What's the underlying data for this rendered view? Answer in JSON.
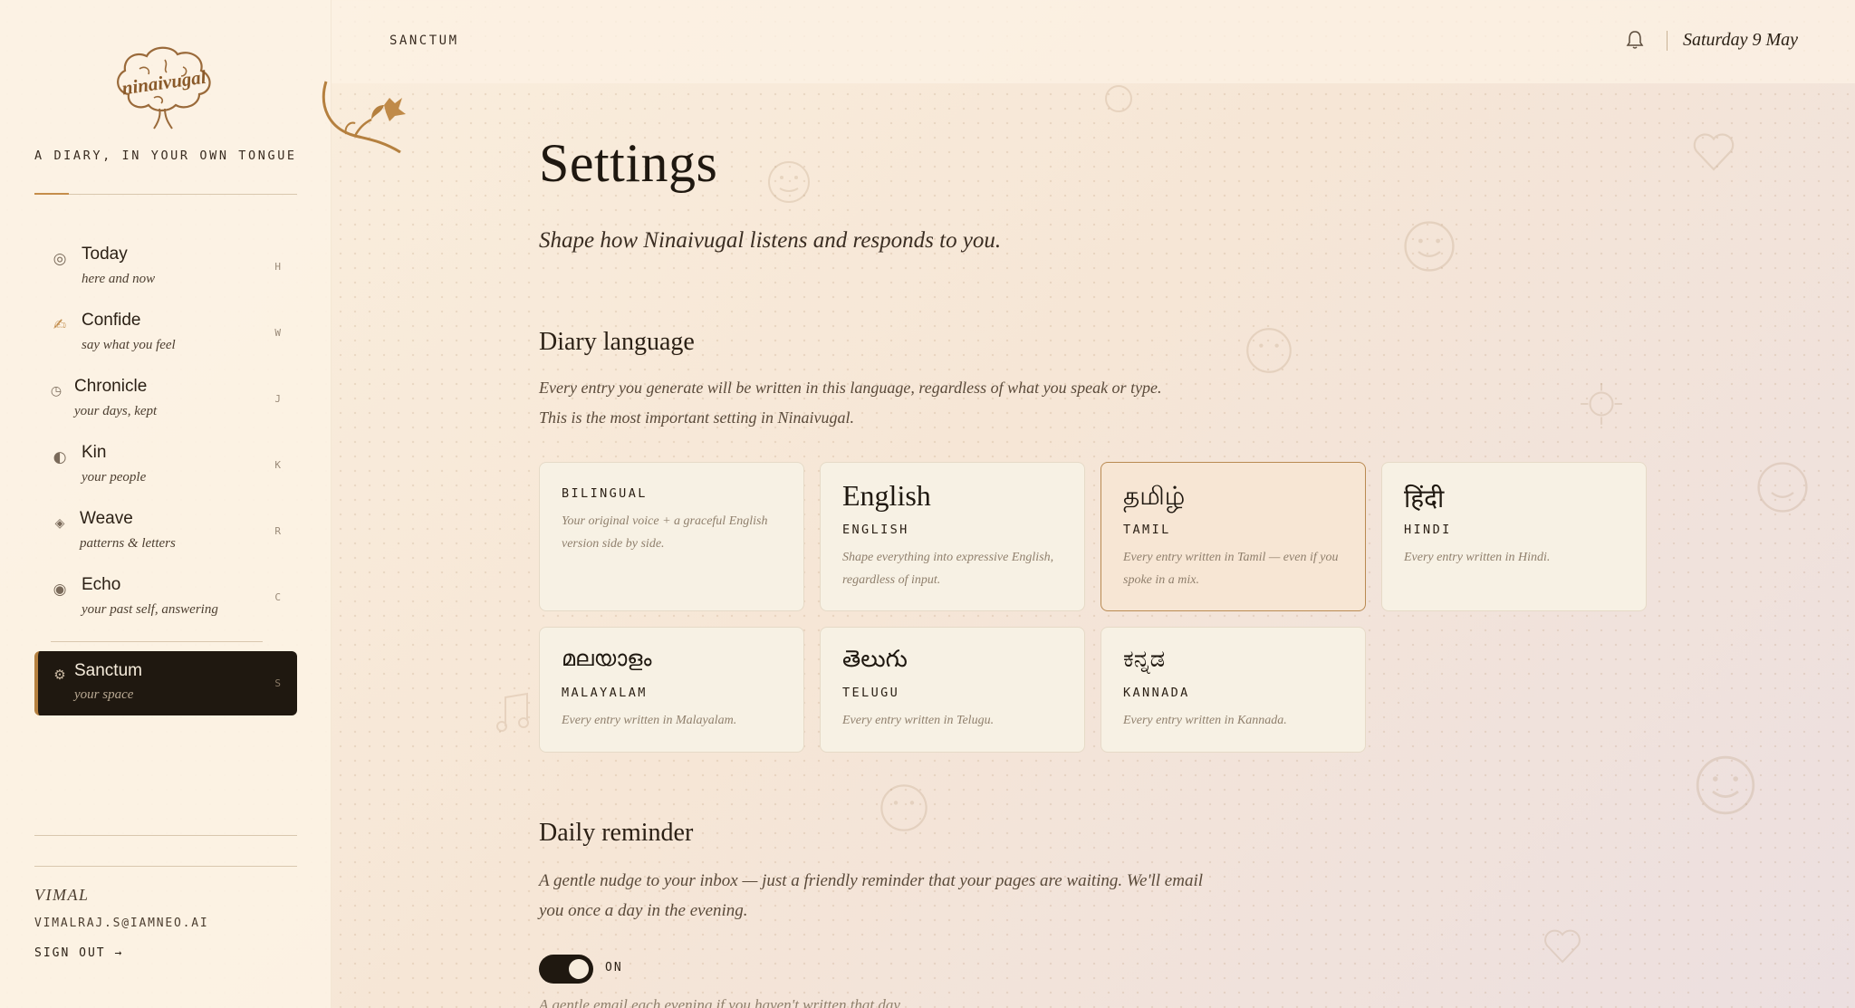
{
  "brand": {
    "logo_text": "ninaivugal",
    "tagline": "A DIARY, IN YOUR OWN TONGUE"
  },
  "nav": {
    "items": [
      {
        "label": "Today",
        "sub": "here and now",
        "key": "H",
        "icon": "circle-icon"
      },
      {
        "label": "Confide",
        "sub": "say what you feel",
        "key": "W",
        "icon": "writing-hand-icon"
      },
      {
        "label": "Chronicle",
        "sub": "your days, kept",
        "key": "J",
        "icon": "clock-icon"
      },
      {
        "label": "Kin",
        "sub": "your people",
        "key": "K",
        "icon": "half-moon-icon"
      },
      {
        "label": "Weave",
        "sub": "patterns & letters",
        "key": "R",
        "icon": "diamond-icon"
      },
      {
        "label": "Echo",
        "sub": "your past self, answering",
        "key": "C",
        "icon": "dot-circle-icon"
      }
    ],
    "active": {
      "label": "Sanctum",
      "sub": "your space",
      "key": "S",
      "icon": "gear-icon"
    }
  },
  "user": {
    "name": "VIMAL",
    "email": "VIMALRAJ.S@IAMNEO.AI",
    "signout": "SIGN OUT →"
  },
  "topbar": {
    "breadcrumb": "SANCTUM",
    "date": "Saturday 9 May"
  },
  "page": {
    "title": "Settings",
    "subtitle": "Shape how Ninaivugal listens and responds to you."
  },
  "diary_language": {
    "heading": "Diary language",
    "desc_line1": "Every entry you generate will be written in this language, regardless of what you speak or type.",
    "desc_line2": "This is the most important setting in Ninaivugal.",
    "options": [
      {
        "native": "",
        "code": "BILINGUAL",
        "desc": "Your original voice + a graceful English version side by side.",
        "selected": false
      },
      {
        "native": "English",
        "code": "ENGLISH",
        "desc": "Shape everything into expressive English, regardless of input.",
        "selected": false
      },
      {
        "native": "தமிழ்",
        "code": "TAMIL",
        "desc": "Every entry written in Tamil — even if you spoke in a mix.",
        "selected": true
      },
      {
        "native": "हिंदी",
        "code": "HINDI",
        "desc": "Every entry written in Hindi.",
        "selected": false
      },
      {
        "native": "മലയാളം",
        "code": "MALAYALAM",
        "desc": "Every entry written in Malayalam.",
        "selected": false
      },
      {
        "native": "తెలుగు",
        "code": "TELUGU",
        "desc": "Every entry written in Telugu.",
        "selected": false
      },
      {
        "native": "ಕನ್ನಡ",
        "code": "KANNADA",
        "desc": "Every entry written in Kannada.",
        "selected": false
      }
    ]
  },
  "daily_reminder": {
    "heading": "Daily reminder",
    "desc_line1": "A gentle nudge to your inbox — just a friendly reminder that your pages are waiting. We'll email",
    "desc_line2": "you once a day in the evening.",
    "toggle_state": "ON",
    "note": "A gentle email each evening if you haven't written that day."
  },
  "colors": {
    "accent": "#b5803f",
    "dark": "#1f1810",
    "selected_card_border": "#b98a52"
  }
}
